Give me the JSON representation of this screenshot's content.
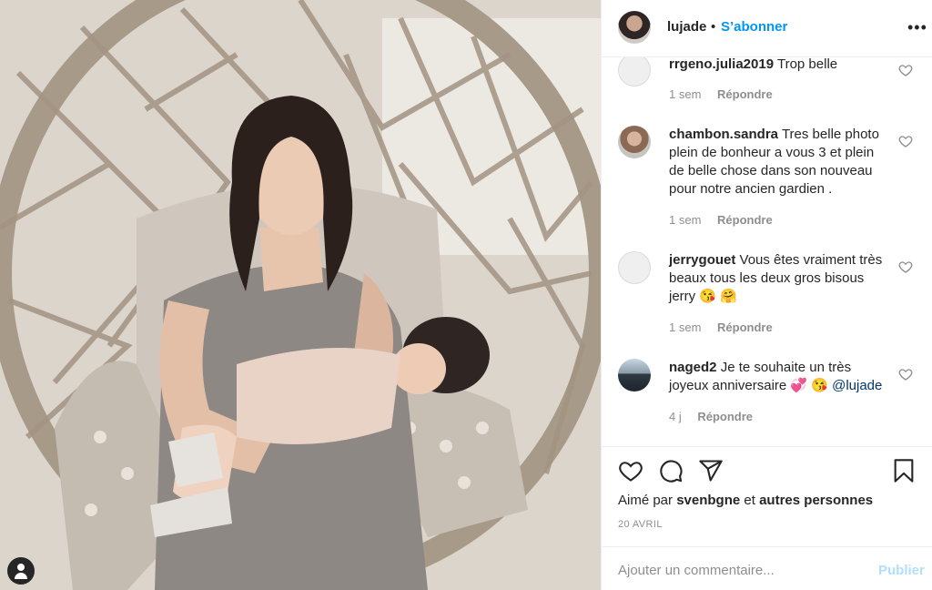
{
  "post": {
    "image_alt": "photo",
    "tag_icon": "user-tag-icon"
  },
  "header": {
    "username": "lujade",
    "separator": "•",
    "follow_label": "S’abonner",
    "more_icon": "more-options-icon"
  },
  "comments": [
    {
      "username": "rrgeno.julia2019",
      "text": "Trop belle",
      "time": "1 sem",
      "reply": "Répondre"
    },
    {
      "username": "chambon.sandra",
      "text": "Tres belle photo plein de bonheur a vous 3 et plein de belle chose dans son nouveau pour notre ancien gardien .",
      "time": "1 sem",
      "reply": "Répondre"
    },
    {
      "username": "jerrygouet",
      "text": "Vous êtes vraiment très beaux tous les deux gros bisous jerry 😘 🤗",
      "time": "1 sem",
      "reply": "Répondre"
    },
    {
      "username": "naged2",
      "text": "Je te souhaite un très joyeux anniversaire 💞 😘",
      "mention": "@lujade",
      "time": "4 j",
      "reply": "Répondre"
    }
  ],
  "actions": {
    "like_icon": "heart-icon",
    "comment_icon": "comment-icon",
    "share_icon": "share-icon",
    "save_icon": "bookmark-icon"
  },
  "likes": {
    "prefix": "Aimé par",
    "user": "svenbgne",
    "joiner": "et",
    "others": "autres personnes"
  },
  "date": "20 AVRIL",
  "composer": {
    "placeholder": "Ajouter un commentaire...",
    "post_label": "Publier"
  },
  "colors": {
    "accent": "#0095f6",
    "post_disabled": "#b2dffc",
    "muted": "#8e8e8e"
  }
}
